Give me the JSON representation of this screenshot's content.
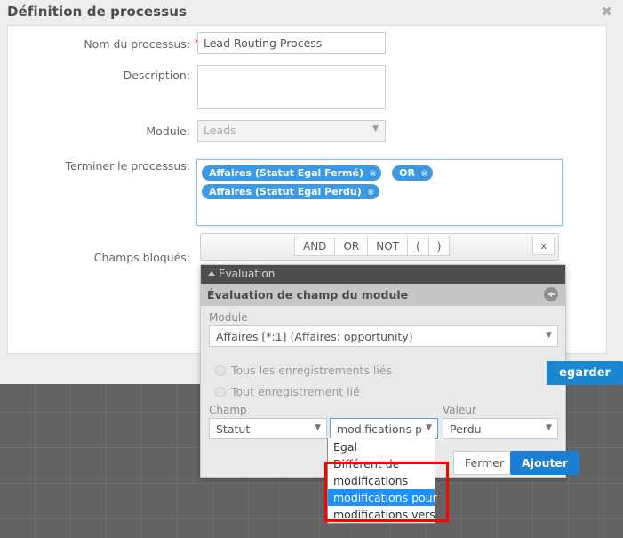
{
  "modal": {
    "title": "Définition de processus",
    "close_icon": "close-icon"
  },
  "form": {
    "name": {
      "label": "Nom du processus:",
      "required_marker": "*",
      "value": "Lead Routing Process"
    },
    "description": {
      "label": "Description:",
      "value": ""
    },
    "module": {
      "label": "Module:",
      "value": "Leads",
      "caret": "▼"
    },
    "terminate": {
      "label": "Terminer le processus:",
      "tags": [
        {
          "text": "Affaires (Statut Egal Fermé)",
          "remove": "✕"
        },
        {
          "text": "OR",
          "remove": "✕"
        },
        {
          "text": "Affaires (Statut Egal Perdu)",
          "remove": "✕"
        }
      ]
    },
    "blocked_fields": {
      "label": "Champs bloqués:"
    }
  },
  "operator_toolbar": {
    "buttons": [
      "AND",
      "OR",
      "NOT",
      "(",
      ")"
    ],
    "clear_label": "x"
  },
  "eval_popup": {
    "header": "Evaluation",
    "subheader": "Évaluation de champ du module",
    "back_icon": "back-arrow-icon",
    "module": {
      "label": "Module",
      "value": "Affaires [*:1] (Affaires: opportunity)",
      "caret": "▼"
    },
    "radios": [
      {
        "label": "Tous les enregistrements liés",
        "selected": false
      },
      {
        "label": "Tout enregistrement lié",
        "selected": false
      }
    ],
    "field": {
      "label": "Champ",
      "value": "Statut",
      "caret": "▼"
    },
    "operator": {
      "value": "modifications p",
      "caret": "▼"
    },
    "value": {
      "label": "Valeur",
      "value": "Perdu",
      "caret": "▼"
    },
    "buttons": {
      "close": "Fermer",
      "add": "Ajouter"
    }
  },
  "operator_options": {
    "above": [
      "Egal",
      "Différent de"
    ],
    "highlighted_group": [
      {
        "label": "modifications",
        "selected": false
      },
      {
        "label": "modifications pour",
        "selected": true
      },
      {
        "label": "modifications vers",
        "selected": false
      }
    ]
  },
  "save_button": {
    "label": "Sauvegarder",
    "visible_text": "egarder"
  },
  "colors": {
    "tag_blue": "#3c9ae4",
    "primary_blue": "#1b7fd4",
    "dark_header": "#4d4d4d",
    "highlight_red": "#ff0000",
    "option_selected": "#1e90ff",
    "canvas_gray": "#636363"
  }
}
